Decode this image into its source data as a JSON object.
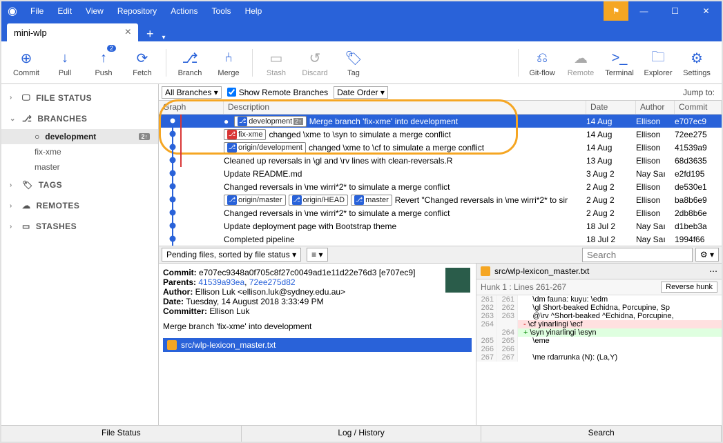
{
  "menu": [
    "File",
    "Edit",
    "View",
    "Repository",
    "Actions",
    "Tools",
    "Help"
  ],
  "tab_name": "mini-wlp",
  "toolbar": [
    {
      "label": "Commit",
      "icon": "⊕"
    },
    {
      "label": "Pull",
      "icon": "↓"
    },
    {
      "label": "Push",
      "icon": "↑",
      "badge": "2"
    },
    {
      "label": "Fetch",
      "icon": "⟳"
    },
    {
      "label": "Branch",
      "icon": "⎇"
    },
    {
      "label": "Merge",
      "icon": "⑃"
    },
    {
      "label": "Stash",
      "icon": "▭",
      "muted": true
    },
    {
      "label": "Discard",
      "icon": "↺",
      "muted": true
    },
    {
      "label": "Tag",
      "icon": "🏷"
    }
  ],
  "toolbar_right": [
    {
      "label": "Git-flow",
      "icon": "⎌"
    },
    {
      "label": "Remote",
      "icon": "☁",
      "muted": true
    },
    {
      "label": "Terminal",
      "icon": ">_"
    },
    {
      "label": "Explorer",
      "icon": "🗀"
    },
    {
      "label": "Settings",
      "icon": "⚙"
    }
  ],
  "sidebar": {
    "sections": [
      {
        "label": "FILE STATUS",
        "icon": "🖵",
        "open": false
      },
      {
        "label": "BRANCHES",
        "icon": "⎇",
        "open": true,
        "items": [
          {
            "name": "development",
            "active": true,
            "count": "2↑",
            "current": true
          },
          {
            "name": "fix-xme"
          },
          {
            "name": "master"
          }
        ]
      },
      {
        "label": "TAGS",
        "icon": "🏷",
        "open": false
      },
      {
        "label": "REMOTES",
        "icon": "☁",
        "open": false
      },
      {
        "label": "STASHES",
        "icon": "▭",
        "open": false
      }
    ]
  },
  "filters": {
    "branches": "All Branches",
    "show_remote": "Show Remote Branches",
    "order": "Date Order",
    "jump": "Jump to:"
  },
  "columns": {
    "graph": "Graph",
    "desc": "Description",
    "date": "Date",
    "author": "Author",
    "commit": "Commit"
  },
  "commits": [
    {
      "chips": [
        {
          "ico": "blue",
          "text": "development",
          "extra": "2↑"
        }
      ],
      "pre": "●",
      "msg": "Merge branch 'fix-xme' into development",
      "date": "14 Aug",
      "author": "Ellison",
      "hash": "e707ec9",
      "selected": true
    },
    {
      "chips": [
        {
          "ico": "red",
          "text": "fix-xme"
        }
      ],
      "msg": "changed \\xme to \\syn to simulate a merge conflict",
      "date": "14 Aug",
      "author": "Ellison",
      "hash": "72ee275"
    },
    {
      "chips": [
        {
          "ico": "blue",
          "text": "origin/development"
        }
      ],
      "msg": "changed \\xme to \\cf to simulate a merge conflict",
      "date": "14 Aug",
      "author": "Ellison",
      "hash": "41539a9"
    },
    {
      "msg": "Cleaned up reversals in \\gl and \\rv lines with clean-reversals.R",
      "date": "13 Aug",
      "author": "Ellison",
      "hash": "68d3635"
    },
    {
      "msg": "Update README.md",
      "date": "3 Aug 2",
      "author": "Nay Saı",
      "hash": "e2fd195"
    },
    {
      "msg": "Changed reversals in \\me wirri*2* to simulate a merge conflict",
      "date": "2 Aug 2",
      "author": "Ellison",
      "hash": "de530e1"
    },
    {
      "chips": [
        {
          "ico": "blue",
          "text": "origin/master"
        },
        {
          "ico": "blue",
          "text": "origin/HEAD"
        },
        {
          "ico": "blue",
          "text": "master"
        }
      ],
      "msg": "Revert \"Changed reversals in \\me wirri*2* to sir",
      "date": "2 Aug 2",
      "author": "Ellison",
      "hash": "ba8b6e9"
    },
    {
      "msg": "Changed reversals in \\me wirri*2* to simulate a merge conflict",
      "date": "2 Aug 2",
      "author": "Ellison",
      "hash": "2db8b6e"
    },
    {
      "msg": "Update deployment page with Bootstrap theme",
      "date": "18 Jul 2",
      "author": "Nay Saı",
      "hash": "d1beb3a"
    },
    {
      "msg": "Completed pipeline",
      "date": "18 Jul 2",
      "author": "Nay Saı",
      "hash": "1994f66"
    }
  ],
  "splitter": {
    "sort": "Pending files, sorted by file status",
    "view": "≡",
    "search_ph": "Search"
  },
  "commit_detail": {
    "hash_label": "Commit:",
    "hash": "e707ec9348a0f705c8f27c0049ad1e11d22e76d3 [e707ec9]",
    "parents_label": "Parents:",
    "parents": [
      "41539a93ea",
      "72ee275d82"
    ],
    "author_label": "Author:",
    "author": "Ellison Luk <ellison.luk@sydney.edu.au>",
    "date_label": "Date:",
    "date": "Tuesday, 14 August 2018 3:33:49 PM",
    "committer_label": "Committer:",
    "committer": "Ellison Luk",
    "message": "Merge branch 'fix-xme' into development",
    "file": "src/wlp-lexicon_master.txt"
  },
  "diff": {
    "file": "src/wlp-lexicon_master.txt",
    "hunk": "Hunk 1 : Lines 261-267",
    "reverse": "Reverse hunk",
    "lines": [
      {
        "a": "261",
        "b": "261",
        "t": "   \\dm fauna: kuyu: \\edm"
      },
      {
        "a": "262",
        "b": "262",
        "t": "   \\gl Short-beaked Echidna, Porcupine, Sp"
      },
      {
        "a": "263",
        "b": "263",
        "t": "   @\\rv ^Short-beaked ^Echidna, Porcupine,"
      },
      {
        "a": "264",
        "b": "",
        "t": "\\cf yinarlingi \\ecf",
        "kind": "del"
      },
      {
        "a": "",
        "b": "264",
        "t": "\\syn yinarlingi \\esyn",
        "kind": "add"
      },
      {
        "a": "265",
        "b": "265",
        "t": "   \\eme"
      },
      {
        "a": "266",
        "b": "266",
        "t": ""
      },
      {
        "a": "267",
        "b": "267",
        "t": "   \\me rdarrunka (N): (La,Y)"
      }
    ]
  },
  "bottom_tabs": [
    "File Status",
    "Log / History",
    "Search"
  ]
}
